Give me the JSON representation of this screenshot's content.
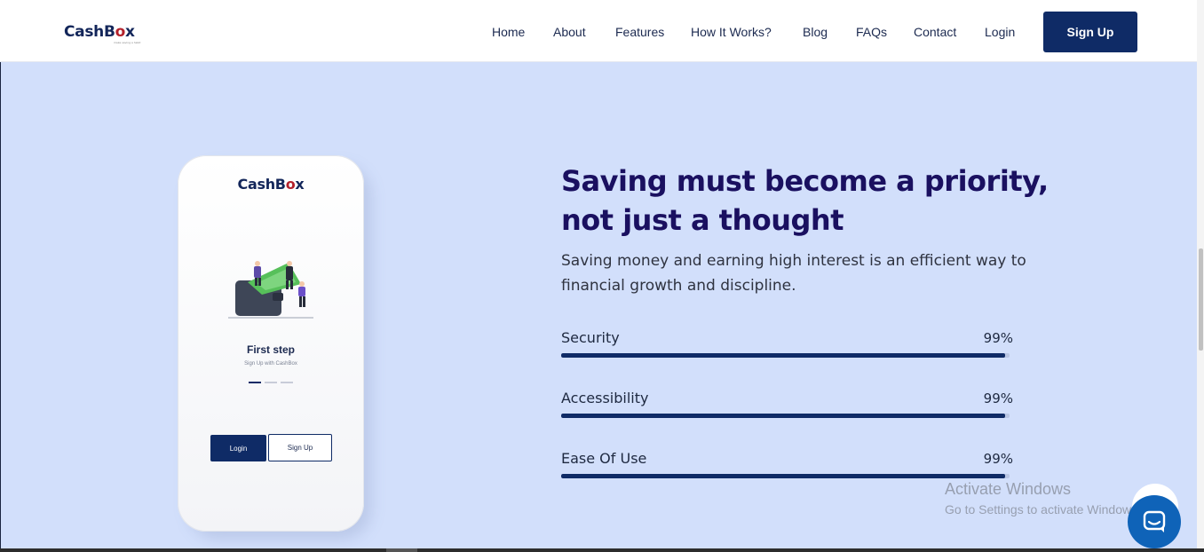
{
  "header": {
    "logo_main": "CashB",
    "logo_accent": "o",
    "logo_end": "x",
    "logo_tagline": "make saving a habit",
    "nav": [
      "Home",
      "About",
      "Features",
      "How It Works?",
      "Blog",
      "FAQs",
      "Contact",
      "Login"
    ],
    "signup_label": "Sign Up"
  },
  "phone": {
    "logo_main": "CashB",
    "logo_accent": "o",
    "logo_end": "x",
    "heading": "First step",
    "subheading": "Sign Up with CashBox",
    "login_label": "Login",
    "signup_label": "Sign Up"
  },
  "hero": {
    "title_line1": "Saving must become a priority,",
    "title_line2": "not just a thought",
    "paragraph": "Saving money and earning high interest is an efficient way to financial growth and discipline."
  },
  "metrics": [
    {
      "label": "Security",
      "value": "99%",
      "fraction": 0.99
    },
    {
      "label": "Accessibility",
      "value": "99%",
      "fraction": 0.99
    },
    {
      "label": "Ease Of Use",
      "value": "99%",
      "fraction": 0.99
    }
  ],
  "watermark": {
    "title": "Activate Windows",
    "subtitle": "Go to Settings to activate Windows."
  },
  "colors": {
    "brand_navy": "#0f2b66",
    "brand_red": "#b3212b",
    "background": "#d2dffb",
    "chat_blue": "#0f63b8"
  },
  "icons": {
    "chat": "chat-bubble-icon"
  }
}
